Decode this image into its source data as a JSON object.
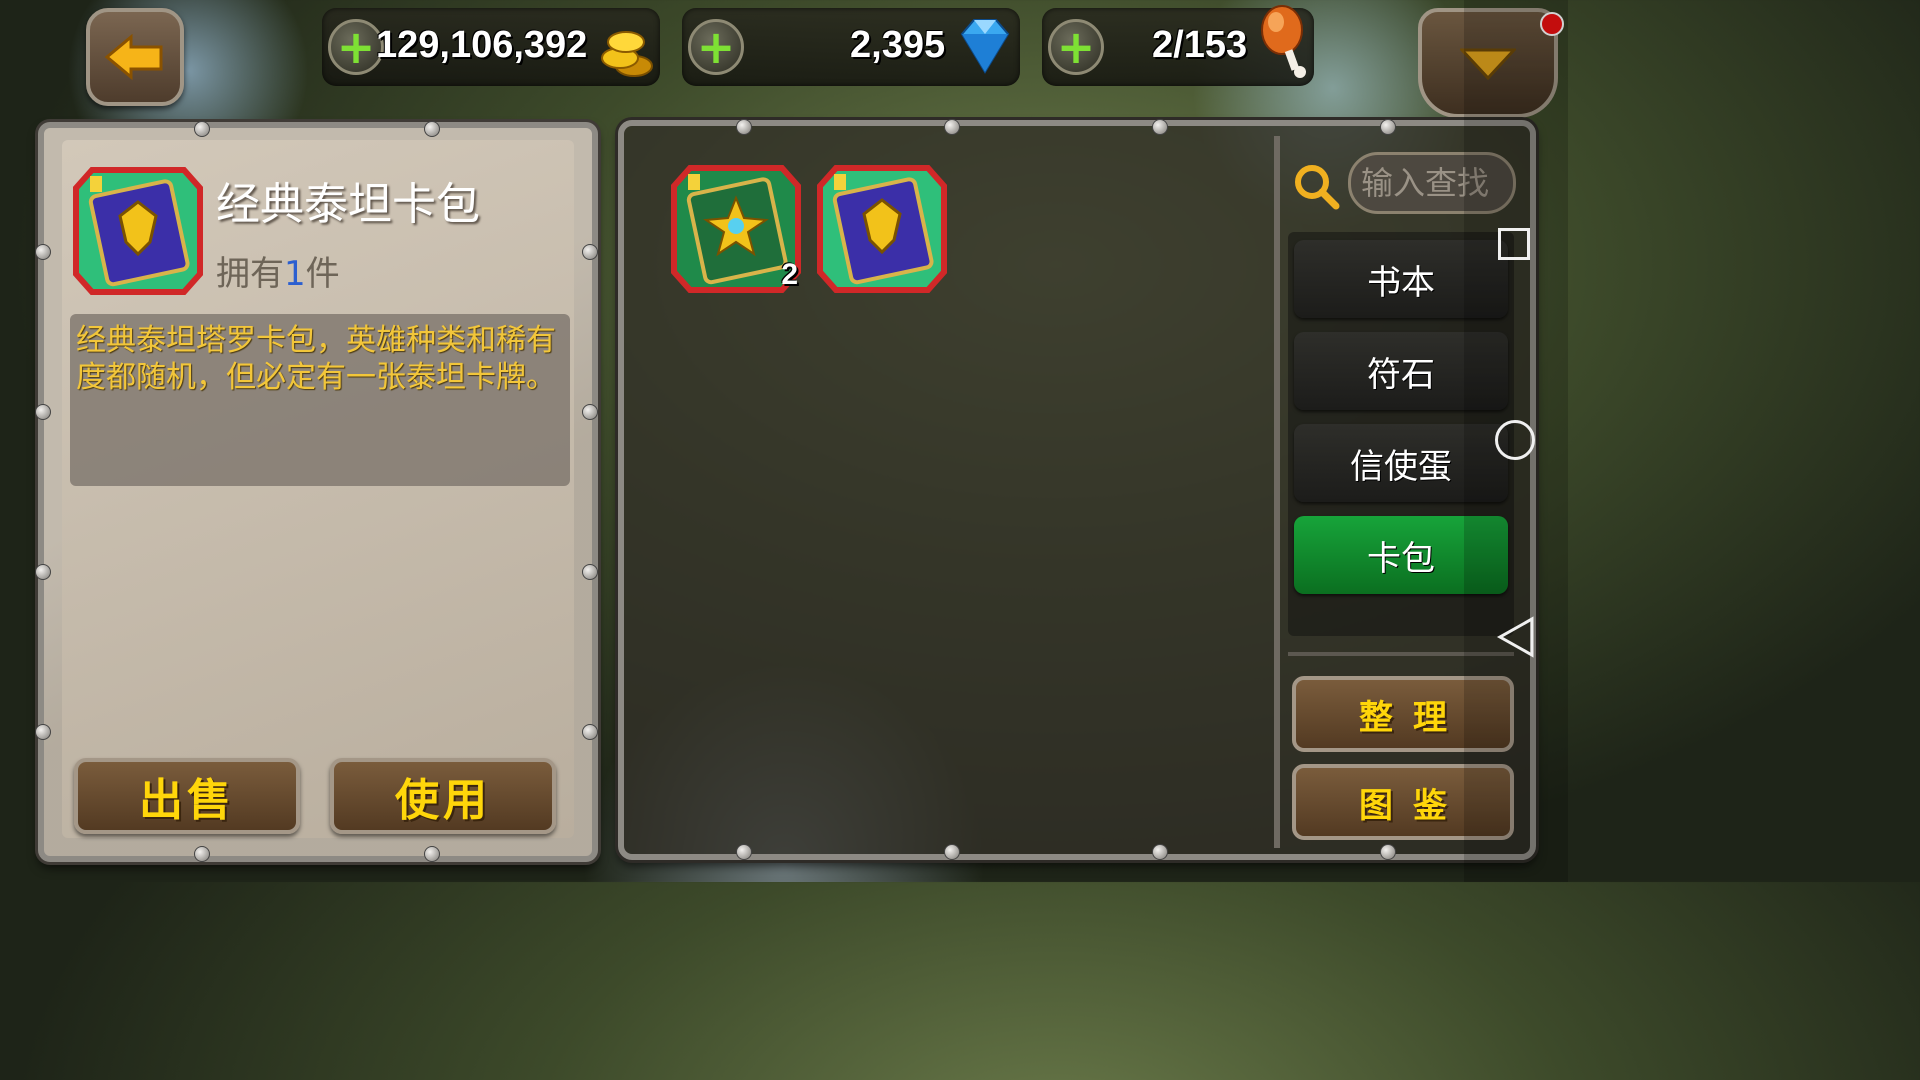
{
  "top_bar": {
    "gold": "129,106,392",
    "gems": "2,395",
    "stamina": "2/153"
  },
  "detail": {
    "item_name": "经典泰坦卡包",
    "owned_prefix": "拥有",
    "owned_count": "1",
    "owned_suffix": "件",
    "description": "经典泰坦塔罗卡包，英雄种类和稀有度都随机，但必定有一张泰坦卡牌。",
    "sell_label": "出售",
    "use_label": "使用"
  },
  "inventory": {
    "slots": [
      {
        "name": "green-card-pack",
        "count": "2"
      },
      {
        "name": "classic-titan-card-pack",
        "count": ""
      }
    ]
  },
  "search": {
    "placeholder": "输入查找"
  },
  "categories": {
    "items": [
      {
        "label": "书本",
        "active": false
      },
      {
        "label": "符石",
        "active": false
      },
      {
        "label": "信使蛋",
        "active": false
      },
      {
        "label": "卡包",
        "active": true
      }
    ]
  },
  "side_buttons": {
    "sort_label": "整理",
    "codex_label": "图鉴"
  },
  "colors": {
    "active_tab": "#17a43a",
    "gold_text": "#ffd60a",
    "desc_text": "#f2c63a"
  }
}
